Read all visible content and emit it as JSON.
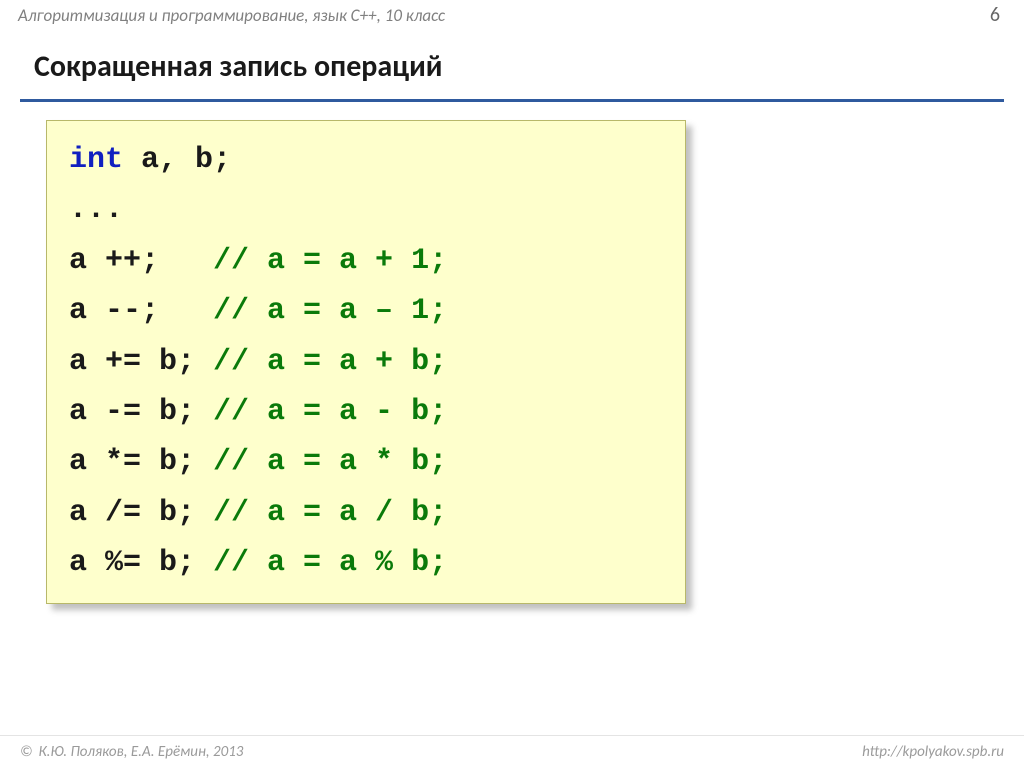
{
  "header": {
    "course": "Алгоритмизация и программирование, язык  C++, 10 класс",
    "pagenum": "6"
  },
  "title": "Сокращенная запись операций",
  "code": {
    "decl_kw": "int",
    "decl_rest": " a, b;",
    "ellipsis": "...",
    "rows": [
      {
        "stmt": "a ++;   ",
        "comment": "// a = a + 1;"
      },
      {
        "stmt": "a --;   ",
        "comment": "// a = a – 1;"
      },
      {
        "stmt": "a += b; ",
        "comment": "// a = a + b;"
      },
      {
        "stmt": "a -= b; ",
        "comment": "// a = a - b;"
      },
      {
        "stmt": "a *= b; ",
        "comment": "// a = a * b;"
      },
      {
        "stmt": "a /= b; ",
        "comment": "// a = a / b;"
      },
      {
        "stmt": "a %= b; ",
        "comment": "// a = a % b;"
      }
    ]
  },
  "footer": {
    "copyright_symbol": "©",
    "authors": " К.Ю. Поляков, Е.А. Ерёмин, 2013",
    "url": "http://kpolyakov.spb.ru"
  }
}
